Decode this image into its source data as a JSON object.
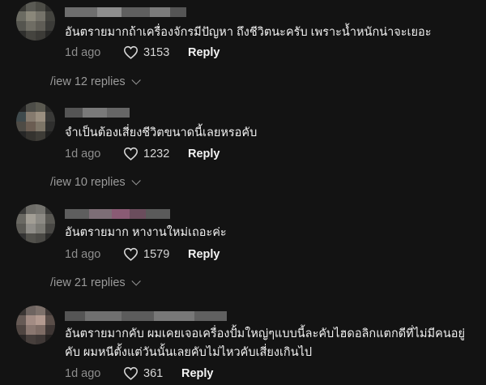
{
  "comments": [
    {
      "text": "อันตรายมากถ้าเครื่องจักรมีปัญหา ถึงชีวิตนะครับ เพราะน้ำหนักน่าจะเยอะ",
      "time": "1d ago",
      "likes": "3153",
      "reply_label": "Reply",
      "view_replies": "/iew 12 replies"
    },
    {
      "text": "จำเป็นต้องเสี่ยงชีวิตขนาดนี้เลยหรอคับ",
      "time": "1d ago",
      "likes": "1232",
      "reply_label": "Reply",
      "view_replies": "/iew 10 replies"
    },
    {
      "text": "อันตรายมาก หางานใหม่เถอะค่ะ",
      "time": "1d ago",
      "likes": "1579",
      "reply_label": "Reply",
      "view_replies": "/iew 21 replies"
    },
    {
      "text": "อันตรายมากคับ ผมเคยเจอเครื่องปั้มใหญ่ๆแบบนี้ละคับไฮดอลิกแตกดีที่ไม่มีคนอยู่คับ ผมหนีตั้งแต่วันนั้นเลยคับไม่ไหวคับเสี่ยงเกินไป",
      "time": "1d ago",
      "likes": "361",
      "reply_label": "Reply"
    }
  ],
  "icons": {
    "like": "heart-outline-icon",
    "expand": "chevron-down-icon"
  },
  "colors": {
    "background": "#131313",
    "text": "#f2f2f2",
    "muted": "#8e8e8e"
  }
}
